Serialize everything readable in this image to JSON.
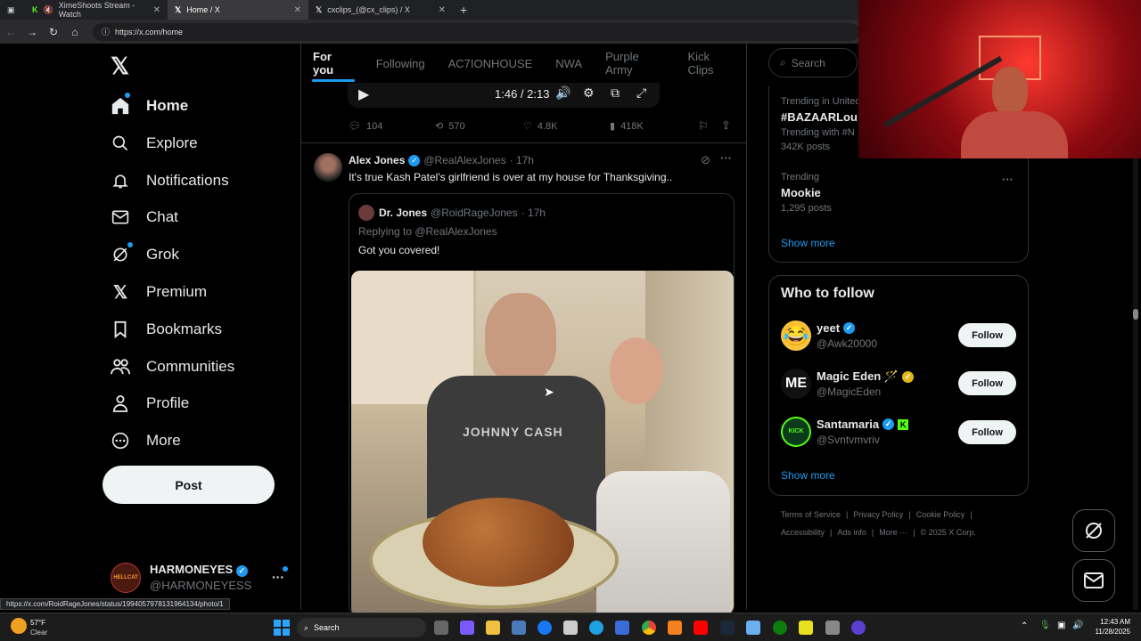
{
  "browser": {
    "tabs": [
      {
        "label": "XimeShoots Stream - Watch",
        "active": false
      },
      {
        "label": "Home / X",
        "active": true
      },
      {
        "label": "cxclips_(@cx_clips) / X",
        "active": false
      }
    ],
    "url": "https://x.com/home",
    "status_url": "https://x.com/RoidRageJones/status/1994057978131964134/photo/1"
  },
  "nav": {
    "items": [
      {
        "label": "Home",
        "icon": "home-icon"
      },
      {
        "label": "Explore",
        "icon": "search-icon"
      },
      {
        "label": "Notifications",
        "icon": "bell-icon"
      },
      {
        "label": "Chat",
        "icon": "mail-icon"
      },
      {
        "label": "Grok",
        "icon": "grok-icon"
      },
      {
        "label": "Premium",
        "icon": "x-logo-icon"
      },
      {
        "label": "Bookmarks",
        "icon": "bookmark-icon"
      },
      {
        "label": "Communities",
        "icon": "people-icon"
      },
      {
        "label": "Profile",
        "icon": "person-icon"
      },
      {
        "label": "More",
        "icon": "more-circle-icon"
      }
    ],
    "post_label": "Post",
    "account": {
      "name": "HARMONEYES",
      "handle": "@HARMONEYESS"
    }
  },
  "feed": {
    "tabs": [
      "For you",
      "Following",
      "AC7IONHOUSE",
      "NWA",
      "Purple Army",
      "Kick Clips"
    ],
    "video": {
      "time": "1:46 / 2:13"
    },
    "prev_stats": {
      "replies": "104",
      "reposts": "570",
      "likes": "4.8K",
      "views": "418K"
    },
    "post": {
      "author": "Alex Jones",
      "handle": "@RealAlexJones",
      "time": "· 17h",
      "text": "It's true Kash Patel's girlfriend is over at my house for Thanksgiving..",
      "quote": {
        "author": "Dr. Jones",
        "handle": "@RoidRageJones",
        "time": "· 17h",
        "replying": "Replying to @RealAlexJones",
        "text": "Got you covered!",
        "shirt_text": "JOHNNY CASH"
      }
    }
  },
  "sidebar": {
    "search_placeholder": "Search",
    "trending": [
      {
        "context": "Trending in United",
        "title": "#BAZAARLou",
        "sub": "Trending with #N",
        "count": "342K posts"
      },
      {
        "context": "Trending",
        "title": "Mookie",
        "count": "1,295 posts"
      }
    ],
    "show_more": "Show more",
    "who_to_follow_title": "Who to follow",
    "follow_label": "Follow",
    "suggestions": [
      {
        "name": "yeet",
        "handle": "@Awk20000"
      },
      {
        "name": "Magic Eden 🪄",
        "handle": "@MagicEden"
      },
      {
        "name": "Santamaria",
        "handle": "@Svntvmvriv"
      }
    ],
    "footer": [
      "Terms of Service",
      "Privacy Policy",
      "Cookie Policy",
      "Accessibility",
      "Ads info",
      "More ···",
      "© 2025 X Corp."
    ]
  },
  "taskbar": {
    "weather_temp": "57°F",
    "weather_cond": "Clear",
    "search_label": "Search",
    "time": "12:43 AM",
    "date": "11/28/2025"
  }
}
